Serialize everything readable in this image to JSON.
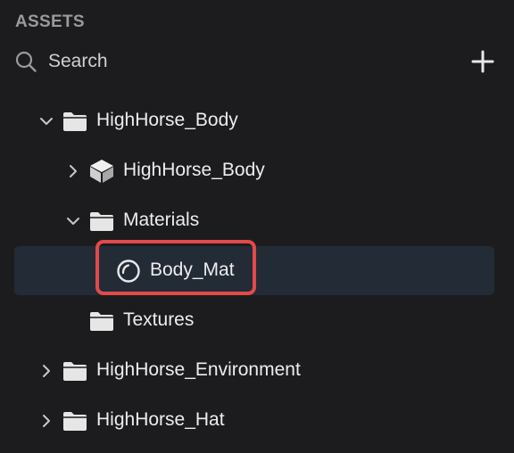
{
  "panel": {
    "title": "ASSETS"
  },
  "search": {
    "placeholder": "Search",
    "value": ""
  },
  "toolbar": {
    "add_icon": "plus-icon"
  },
  "tree": [
    {
      "label": "HighHorse_Body",
      "icon": "folder-icon",
      "chevron": "chevron-down-icon",
      "depth": 0,
      "expanded": true
    },
    {
      "label": "HighHorse_Body",
      "icon": "mesh-cube-icon",
      "chevron": "chevron-right-icon",
      "depth": 1,
      "expanded": false
    },
    {
      "label": "Materials",
      "icon": "folder-icon",
      "chevron": "chevron-down-icon",
      "depth": 1,
      "expanded": true
    },
    {
      "label": "Body_Mat",
      "icon": "material-icon",
      "chevron": "none",
      "depth": 2,
      "selected": true,
      "highlighted": true
    },
    {
      "label": "Textures",
      "icon": "folder-icon",
      "chevron": "none",
      "depth": 1,
      "expanded": false
    },
    {
      "label": "HighHorse_Environment",
      "icon": "folder-icon",
      "chevron": "chevron-right-icon",
      "depth": 0,
      "expanded": false
    },
    {
      "label": "HighHorse_Hat",
      "icon": "folder-icon",
      "chevron": "chevron-right-icon",
      "depth": 0,
      "expanded": false
    }
  ],
  "colors": {
    "background": "#1c1c1e",
    "selected_row": "#232b36",
    "highlight_border": "#e24a4a",
    "icon": "#e8e8e8",
    "section_title": "#9a9a9e"
  }
}
